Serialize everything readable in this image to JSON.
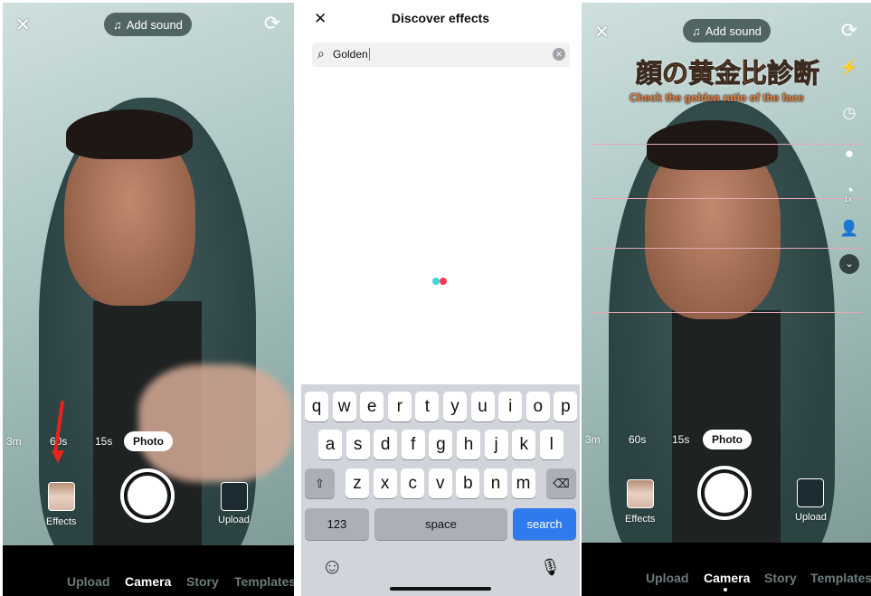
{
  "left_panel": {
    "add_sound": "Add sound",
    "durations": [
      "3m",
      "60s",
      "15s"
    ],
    "mode": "Photo",
    "effects_label": "Effects",
    "upload_label": "Upload",
    "nav": [
      "Upload",
      "Camera",
      "Story",
      "Templates"
    ],
    "active_nav": "Camera",
    "annotation_color": "#e8231b"
  },
  "middle_panel": {
    "title": "Discover effects",
    "search_value": "Golden",
    "loading_colors": [
      "#3fd6d9",
      "#f33b57"
    ],
    "keyboard": {
      "rows": [
        [
          "q",
          "w",
          "e",
          "r",
          "t",
          "y",
          "u",
          "i",
          "o",
          "p"
        ],
        [
          "a",
          "s",
          "d",
          "f",
          "g",
          "h",
          "j",
          "k",
          "l"
        ],
        [
          "z",
          "x",
          "c",
          "v",
          "b",
          "n",
          "m"
        ]
      ],
      "numbers": "123",
      "space": "space",
      "search": "search",
      "search_color": "#2f7bed"
    }
  },
  "right_panel": {
    "add_sound": "Add sound",
    "effect_title": "顔の黄金比診断",
    "effect_subtitle": "Check the golden ratio of the face",
    "zoom_label": "1x",
    "durations": [
      "3m",
      "60s",
      "15s"
    ],
    "mode": "Photo",
    "effects_label": "Effects",
    "upload_label": "Upload",
    "nav": [
      "Upload",
      "Camera",
      "Story",
      "Templates"
    ],
    "active_nav": "Camera"
  }
}
